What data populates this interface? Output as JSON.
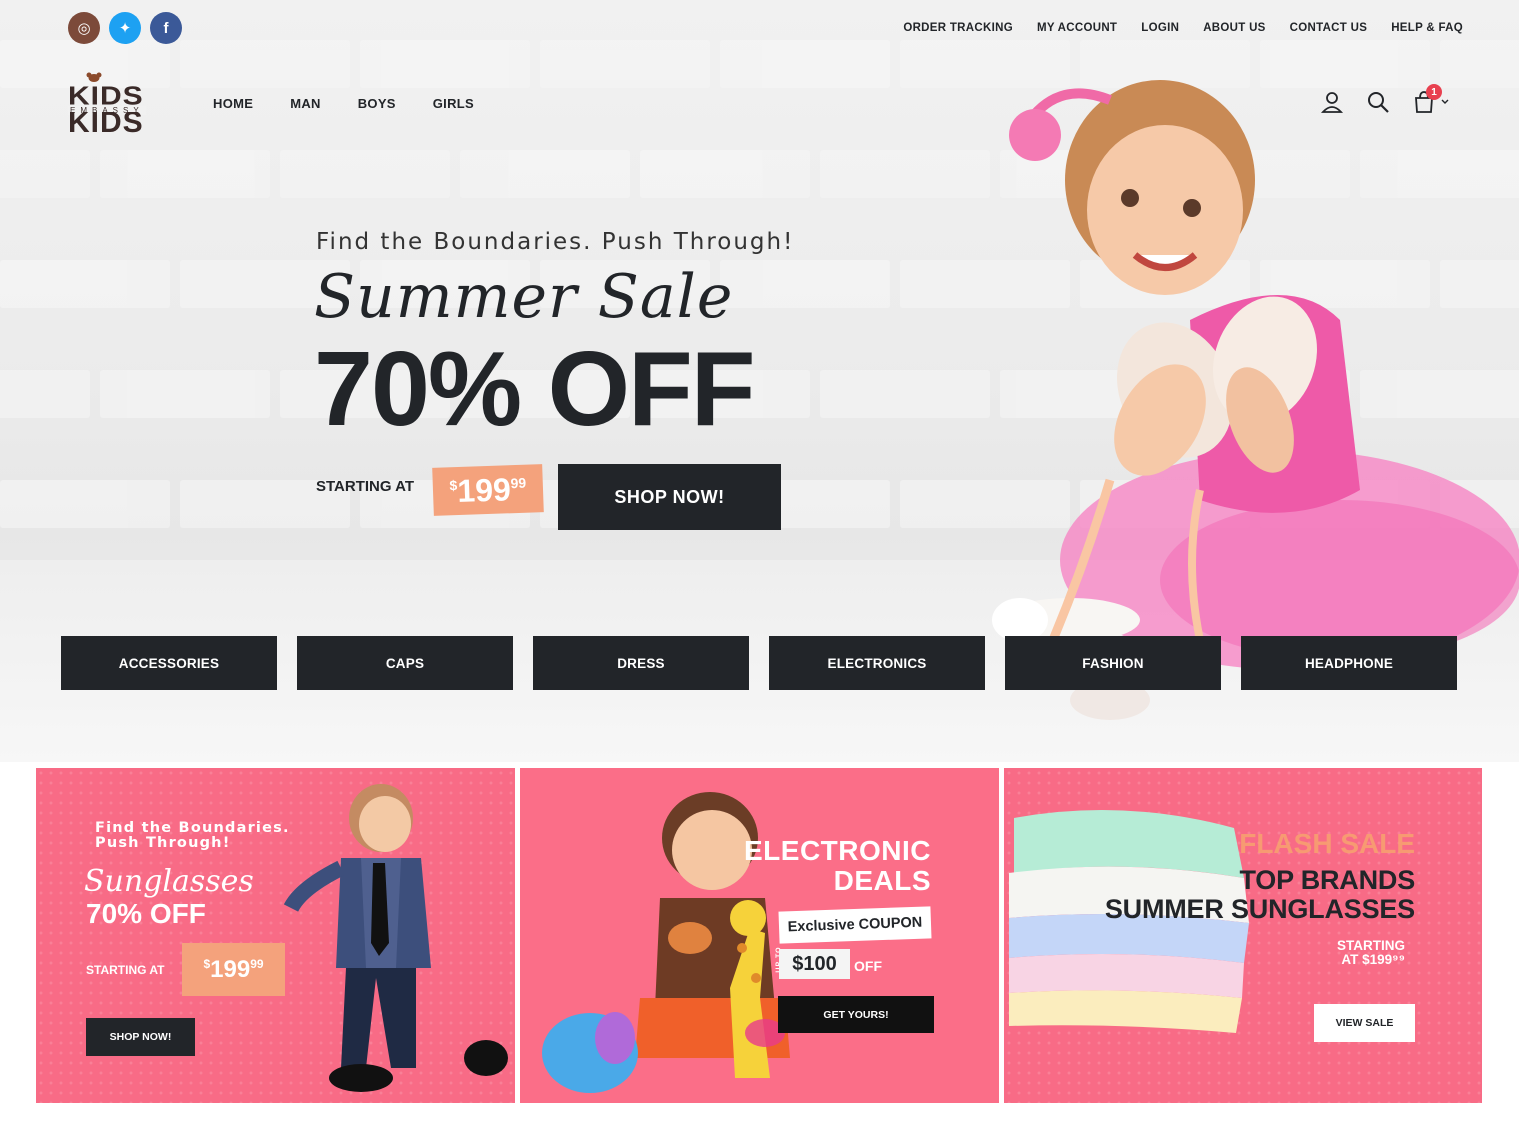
{
  "socials": [
    {
      "icon": "instagram-icon",
      "glyph": "◎",
      "color": "#7c4a3a"
    },
    {
      "icon": "twitter-icon",
      "glyph": "✦",
      "color": "#1da1f2"
    },
    {
      "icon": "facebook-icon",
      "glyph": "f",
      "color": "#3b5998"
    }
  ],
  "top_links": [
    "ORDER TRACKING",
    "MY ACCOUNT",
    "LOGIN",
    "ABOUT US",
    "CONTACT US",
    "HELP & FAQ"
  ],
  "logo": {
    "line1": "KIDS",
    "line2": "EMBASSY",
    "line3": "KIDS"
  },
  "main_nav": [
    "HOME",
    "MAN",
    "BOYS",
    "GIRLS"
  ],
  "header_icons": {
    "account": "user-icon",
    "search": "search-icon",
    "cart": "cart-icon",
    "cart_count": "1",
    "chevron": "chevron-down-icon"
  },
  "hero": {
    "tagline": "Find the Boundaries. Push Through!",
    "script_title": "Summer Sale",
    "headline": "70% OFF",
    "starting_label": "STARTING AT",
    "price_currency": "$",
    "price_main": "199",
    "price_cents": "99",
    "cta": "SHOP NOW!"
  },
  "categories": [
    "ACCESSORIES",
    "CAPS",
    "DRESS",
    "ELECTRONICS",
    "FASHION",
    "HEADPHONE"
  ],
  "banner1": {
    "tagline": "Find the Boundaries. Push Through!",
    "script": "Sunglasses",
    "headline": "70% OFF",
    "starting_label": "STARTING AT",
    "price_currency": "$",
    "price_main": "199",
    "price_cents": "99",
    "cta": "SHOP NOW!"
  },
  "banner2": {
    "title_line1": "ELECTRONIC",
    "title_line2": "DEALS",
    "coupon": "Exclusive COUPON",
    "upto": "UP TO",
    "amount": "$100",
    "off": "OFF",
    "cta": "GET YOURS!"
  },
  "banner3": {
    "flash": "FLASH SALE",
    "line1": "TOP BRANDS",
    "line2": "SUMMER SUNGLASSES",
    "starting": "STARTING",
    "starting_price": "AT $199⁹⁹",
    "cta": "VIEW SALE"
  },
  "colors": {
    "dark": "#222529",
    "pink": "#f86b86",
    "peach": "#f4a27c",
    "badge": "#e8404f"
  }
}
